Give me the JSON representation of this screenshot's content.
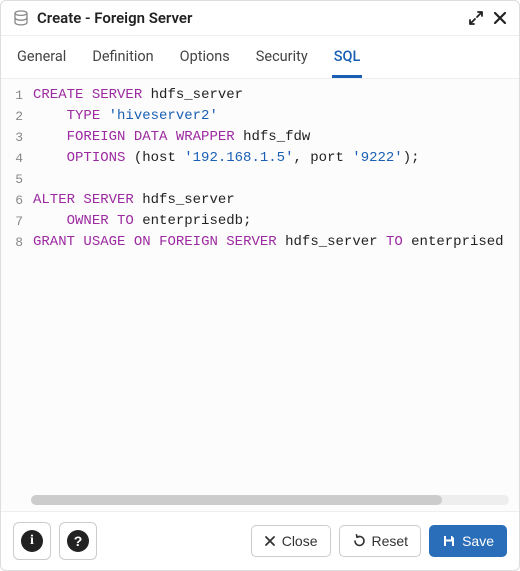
{
  "header": {
    "title": "Create - Foreign Server"
  },
  "tabs": [
    {
      "id": "general",
      "label": "General",
      "active": false
    },
    {
      "id": "definition",
      "label": "Definition",
      "active": false
    },
    {
      "id": "options",
      "label": "Options",
      "active": false
    },
    {
      "id": "security",
      "label": "Security",
      "active": false
    },
    {
      "id": "sql",
      "label": "SQL",
      "active": true
    }
  ],
  "sql": {
    "line_numbers": [
      "1",
      "2",
      "3",
      "4",
      "5",
      "6",
      "7",
      "8"
    ],
    "tokens": [
      [
        {
          "t": "kw",
          "v": "CREATE"
        },
        {
          "t": "sp"
        },
        {
          "t": "kw",
          "v": "SERVER"
        },
        {
          "t": "sp"
        },
        {
          "t": "ident",
          "v": "hdfs_server"
        }
      ],
      [
        {
          "t": "indent",
          "n": 4
        },
        {
          "t": "kw",
          "v": "TYPE"
        },
        {
          "t": "sp"
        },
        {
          "t": "str",
          "v": "'hiveserver2'"
        }
      ],
      [
        {
          "t": "indent",
          "n": 4
        },
        {
          "t": "kw",
          "v": "FOREIGN"
        },
        {
          "t": "sp"
        },
        {
          "t": "kw",
          "v": "DATA"
        },
        {
          "t": "sp"
        },
        {
          "t": "kw",
          "v": "WRAPPER"
        },
        {
          "t": "sp"
        },
        {
          "t": "ident",
          "v": "hdfs_fdw"
        }
      ],
      [
        {
          "t": "indent",
          "n": 4
        },
        {
          "t": "kw",
          "v": "OPTIONS"
        },
        {
          "t": "sp"
        },
        {
          "t": "paren",
          "v": "("
        },
        {
          "t": "ident",
          "v": "host"
        },
        {
          "t": "sp"
        },
        {
          "t": "str",
          "v": "'192.168.1.5'"
        },
        {
          "t": "comma",
          "v": ","
        },
        {
          "t": "sp"
        },
        {
          "t": "ident",
          "v": "port"
        },
        {
          "t": "sp"
        },
        {
          "t": "str",
          "v": "'9222'"
        },
        {
          "t": "paren",
          "v": ")"
        },
        {
          "t": "semi",
          "v": ";"
        }
      ],
      [],
      [
        {
          "t": "kw",
          "v": "ALTER"
        },
        {
          "t": "sp"
        },
        {
          "t": "kw",
          "v": "SERVER"
        },
        {
          "t": "sp"
        },
        {
          "t": "ident",
          "v": "hdfs_server"
        }
      ],
      [
        {
          "t": "indent",
          "n": 4
        },
        {
          "t": "kw",
          "v": "OWNER"
        },
        {
          "t": "sp"
        },
        {
          "t": "kw",
          "v": "TO"
        },
        {
          "t": "sp"
        },
        {
          "t": "ident",
          "v": "enterprisedb"
        },
        {
          "t": "semi",
          "v": ";"
        }
      ],
      [
        {
          "t": "kw",
          "v": "GRANT"
        },
        {
          "t": "sp"
        },
        {
          "t": "kw",
          "v": "USAGE"
        },
        {
          "t": "sp"
        },
        {
          "t": "kw",
          "v": "ON"
        },
        {
          "t": "sp"
        },
        {
          "t": "kw",
          "v": "FOREIGN"
        },
        {
          "t": "sp"
        },
        {
          "t": "kw",
          "v": "SERVER"
        },
        {
          "t": "sp"
        },
        {
          "t": "ident",
          "v": "hdfs_server"
        },
        {
          "t": "sp"
        },
        {
          "t": "kw",
          "v": "TO"
        },
        {
          "t": "sp"
        },
        {
          "t": "ident",
          "v": "enterprised"
        }
      ]
    ]
  },
  "footer": {
    "close_label": "Close",
    "reset_label": "Reset",
    "save_label": "Save"
  },
  "glyphs": {
    "info": "i",
    "help": "?"
  }
}
